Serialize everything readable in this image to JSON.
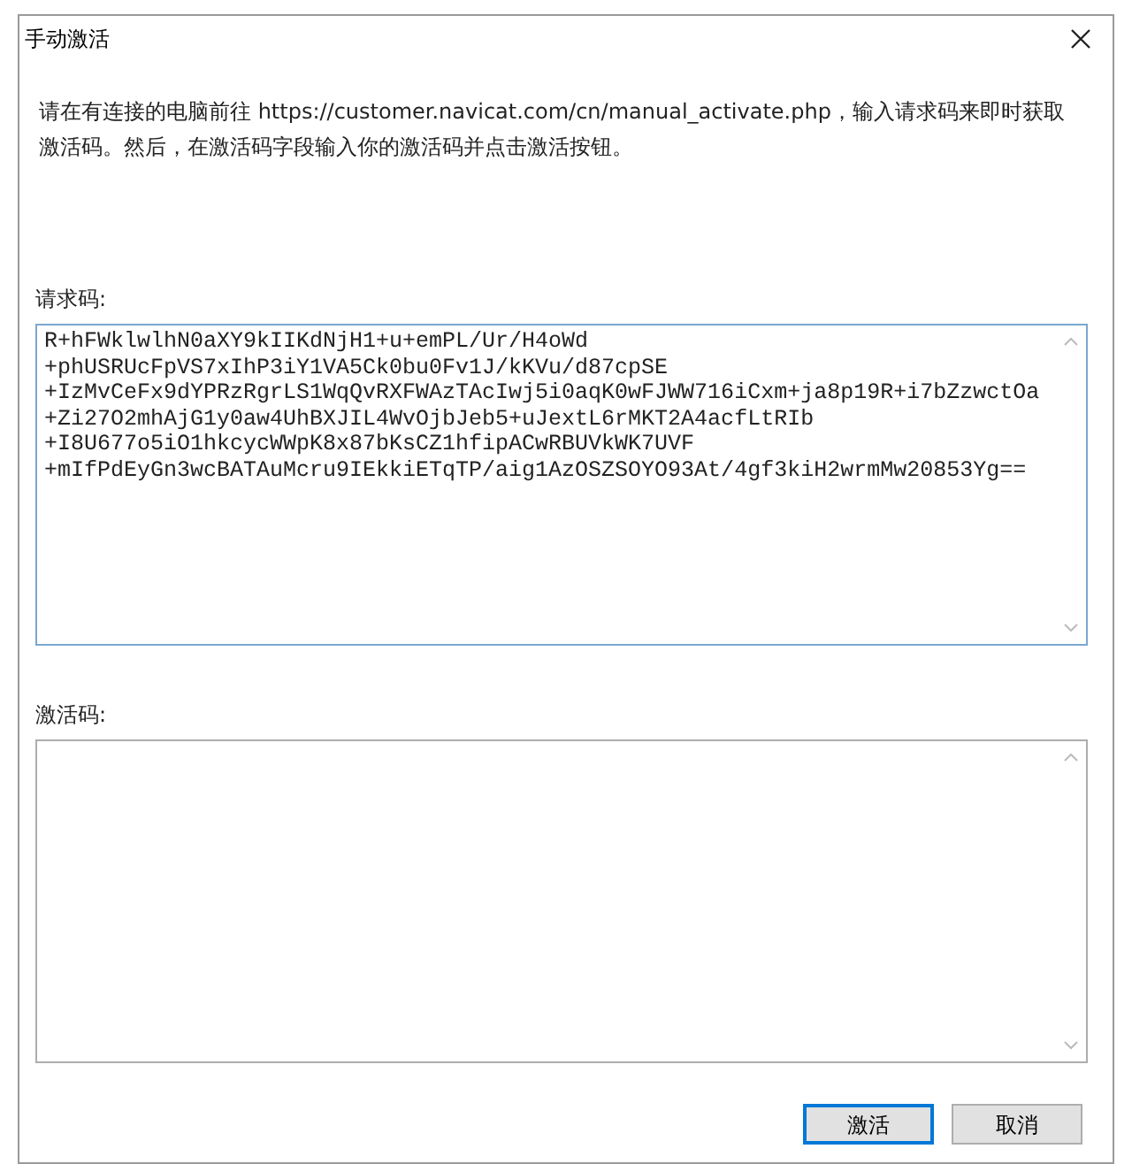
{
  "window": {
    "title": "手动激活"
  },
  "instructions": "请在有连接的电脑前往 https://customer.navicat.com/cn/manual_activate.php，输入请求码来即时获取激活码。然后，在激活码字段输入你的激活码并点击激活按钮。",
  "request_code": {
    "label": "请求码:",
    "value": "R+hFWklwlhN0aXY9kIIKdNjH1+u+emPL/Ur/H4oWd\n+phUSRUcFpVS7xIhP3iY1VA5Ck0bu0Fv1J/kKVu/d87cpSE\n+IzMvCeFx9dYPRzRgrLS1WqQvRXFWAzTAcIwj5i0aqK0wFJWW716iCxm+ja8p19R+i7bZzwctOa\n+Zi27O2mhAjG1y0aw4UhBXJIL4WvOjbJeb5+uJextL6rMKT2A4acfLtRIb\n+I8U677o5iO1hkcycWWpK8x87bKsCZ1hfipACwRBUVkWK7UVF\n+mIfPdEyGn3wcBATAuMcru9IEkkiETqTP/aig1AzOSZSOYO93At/4gf3kiH2wrmMw20853Yg=="
  },
  "activation_code": {
    "label": "激活码:"
  },
  "buttons": [
    {
      "label": "激活",
      "default": true
    },
    {
      "label": "取消",
      "default": false
    }
  ]
}
